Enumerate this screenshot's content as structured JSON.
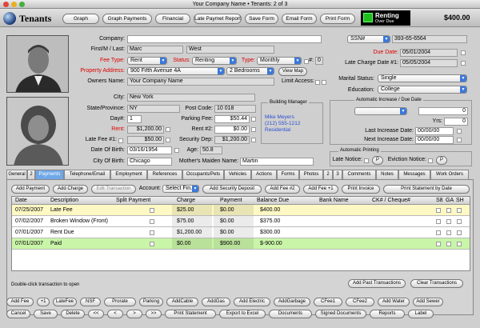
{
  "window": {
    "title": "Your Company Name  •  Tenants: 2 of 3"
  },
  "app": {
    "name": "Tenants"
  },
  "toolbar": {
    "buttons": [
      "Graph",
      "Graph Payments",
      "Financial",
      "Late Paymet Report",
      "Save Form",
      "Email Form",
      "Print Form"
    ]
  },
  "status": {
    "title": "Renting",
    "subtitle": "Over Due",
    "amount": "$400.00",
    "indicator_color": "#1fbf1f"
  },
  "form": {
    "company_label": "Company:",
    "company": "",
    "firstlast_label": "First/M / Last:",
    "first": "Marc",
    "last": "West",
    "feetype_label": "Fee Type:",
    "feetype": "Rent",
    "status_label": "Status:",
    "status": "Renting",
    "type_label": "Type:",
    "type": "Monthly",
    "num_label": "#:",
    "num": "0",
    "property_label": "Property Address:",
    "property": "900 Fifth Avenue 4A",
    "bedrooms": "2 Bedrooms",
    "viewmap": "View Map",
    "owner_label": "Owners Name:",
    "owner": "Your Company Name",
    "limit_label": "Limit Access:",
    "city_label": "City:",
    "city": "New York",
    "state_label": "State/Province:",
    "state": "NY",
    "postcode_label": "Post Code:",
    "postcode": "10 018",
    "day_label": "Day#:",
    "day": "1",
    "parking_label": "Parking Fee:",
    "parking": "$50.44",
    "rent_label": "Rent:",
    "rent": "$1,200.00",
    "rent2_label": "Rent #2:",
    "rent2": "$0.00",
    "latefee_label": "Late Fee #1:",
    "latefee": "$50.00",
    "security_label": "Security Dep:",
    "security": "$1,200.00",
    "dob_label": "Date Of Birth:",
    "dob": "03/16/1954",
    "age_label": "Age:",
    "age": "50.8",
    "cob_label": "City Of Birth:",
    "cob": "Chicago",
    "maiden_label": "Mother's Maiden Name:",
    "maiden": "Martin",
    "manager_label": "Building Manager",
    "manager_lines": [
      "Mike Meyers",
      "(212) 555-1212",
      "Residential"
    ],
    "ssn_type": "SSN#",
    "ssn": "393-65-6564",
    "duedate_label": "Due Date:",
    "duedate": "05/01/2004",
    "latecharge_label": "Late Charge Date #1:",
    "latecharge": "05/05/2004",
    "marital_label": "Marital Status:",
    "marital": "Single",
    "education_label": "Education:",
    "education": "College",
    "auto_label": "Automatic Increase / Due Date",
    "auto_val": "0",
    "yrs_label": "Yrs:",
    "yrs": "0",
    "lastinc_label": "Last Increase Date:",
    "lastinc": "00/00/00",
    "nextinc_label": "Next Increase Date:",
    "nextinc": "00/00/00",
    "autoprint_label": "Automatic Printing",
    "latenotice_label": "Late Notice:",
    "eviction_label": "Eviction Notice:",
    "p": "P"
  },
  "tabs": [
    "General",
    "2",
    "Payments",
    "Telephone/Email",
    "Employment",
    "References",
    "Occupants/Pets",
    "Vehicles",
    "Actions",
    "Forms",
    "Photos",
    "2",
    "3",
    "Comments",
    "Notes",
    "Messages",
    "Work Orders"
  ],
  "payments": {
    "buttons": {
      "add_payment": "Add Payment",
      "add_charge": "Add Charge",
      "edit_transaction": "Edit Transaction",
      "account_label": "Account:",
      "account": "Select Fin...",
      "add_security": "Add Security Deposit",
      "add_fee2": "Add Fee #2",
      "add_fee1": "Add Fee +1",
      "print_invoice": "Print Invoice",
      "print_statement": "Print Statement by Date"
    },
    "columns": [
      "Date",
      "Description",
      "Split Payment",
      "Charge",
      "Payment",
      "Balance Due",
      "Bank Name",
      "CK# / Cheque#",
      "S8",
      "GA",
      "SH"
    ],
    "rows": [
      {
        "date": "07/25/2007",
        "desc": "Late Fee",
        "charge": "$25.00",
        "payment": "$0.00",
        "balance": "$400.00",
        "color": "#fdf8c4"
      },
      {
        "date": "07/02/2007",
        "desc": "Broken Window (Front)",
        "charge": "$75.00",
        "payment": "$0.00",
        "balance": "$375.00",
        "color": "#ffffff"
      },
      {
        "date": "07/01/2007",
        "desc": "Rent Due",
        "charge": "$1,200.00",
        "payment": "$0.00",
        "balance": "$300.00",
        "color": "#ffffff"
      },
      {
        "date": "07/01/2007",
        "desc": "Paid",
        "charge": "$0.00",
        "payment": "$900.00",
        "balance": "$-900.00",
        "color": "#c9f5a8"
      }
    ],
    "hint": "Double-click transaction to open",
    "add_past": "Add Past Transactions",
    "clear": "Clear Transactions"
  },
  "bottom_row1": [
    "Add Fee",
    "+1",
    "LateFee",
    "NSF",
    "Prorate",
    "Parking",
    "AddCable",
    "AddGas",
    "Add Electric",
    "AddGarbage",
    "CFee1",
    "CFee2",
    "Add Water",
    "Add Sewer"
  ],
  "bottom_row2": [
    "Cancel",
    "Save",
    "Delete",
    "<<",
    "<",
    ">",
    ">>",
    "Print Statement",
    "Export to Excel",
    "Documents",
    "Signed Documents",
    "Reports",
    "Label"
  ]
}
